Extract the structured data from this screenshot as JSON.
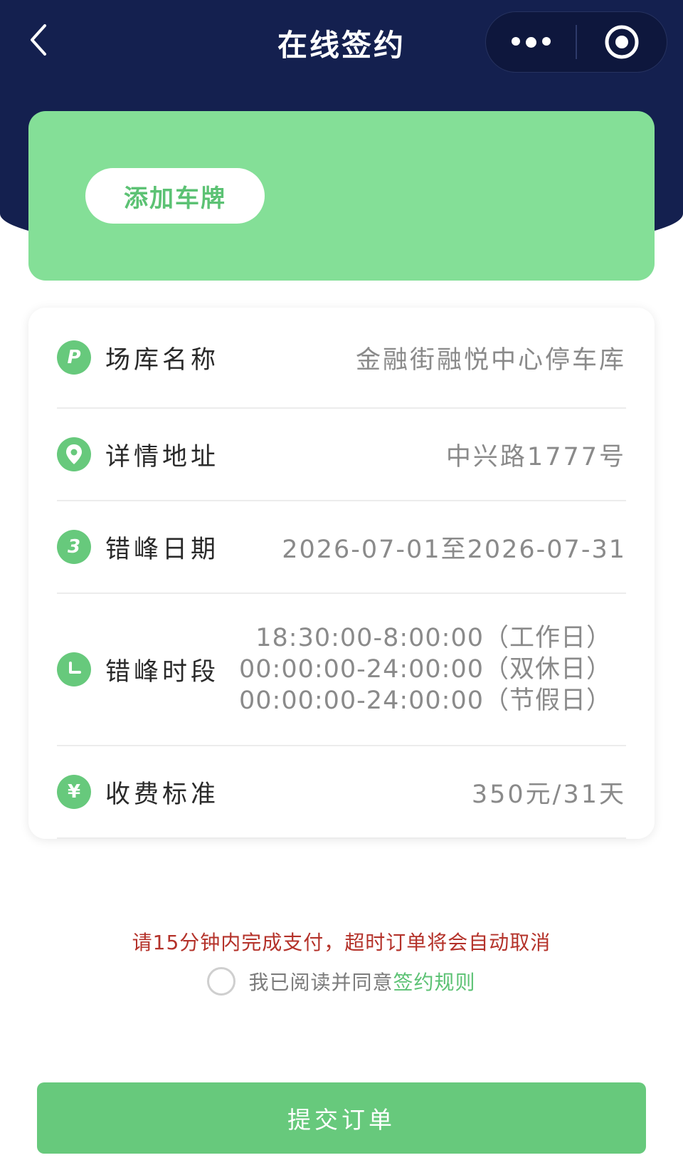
{
  "header": {
    "title": "在线签约",
    "back_icon": "chevron-left-icon",
    "more_icon": "more-dots-icon",
    "close_icon": "target-circle-icon",
    "background_color": "#14204f"
  },
  "plate_card": {
    "add_plate_label": "添加车牌",
    "background_color": "#84df97"
  },
  "info": {
    "rows": [
      {
        "icon": "parking-icon",
        "icon_text": "P",
        "label": "场库名称",
        "value": "金融街融悦中心停车库"
      },
      {
        "icon": "location-pin-icon",
        "icon_text": "",
        "label": "详情地址",
        "value": "中兴路1777号"
      },
      {
        "icon": "calendar-icon",
        "icon_text": "3",
        "label": "错峰日期",
        "value": "2026-07-01至2026-07-31"
      },
      {
        "icon": "clock-icon",
        "icon_text": "",
        "label": "错峰时段",
        "values": [
          "18:30:00-8:00:00（工作日）",
          "00:00:00-24:00:00（双休日）",
          "00:00:00-24:00:00（节假日）"
        ]
      },
      {
        "icon": "yuan-icon",
        "icon_text": "¥",
        "label": "收费标准",
        "value": "350元/31天"
      }
    ]
  },
  "notice": {
    "warning": "请15分钟内完成支付，超时订单将会自动取消",
    "agree_text": "我已阅读并同意",
    "rules_link": "签约规则",
    "warning_color": "#b4322a"
  },
  "submit": {
    "label": "提交订单",
    "color": "#67c97c"
  }
}
